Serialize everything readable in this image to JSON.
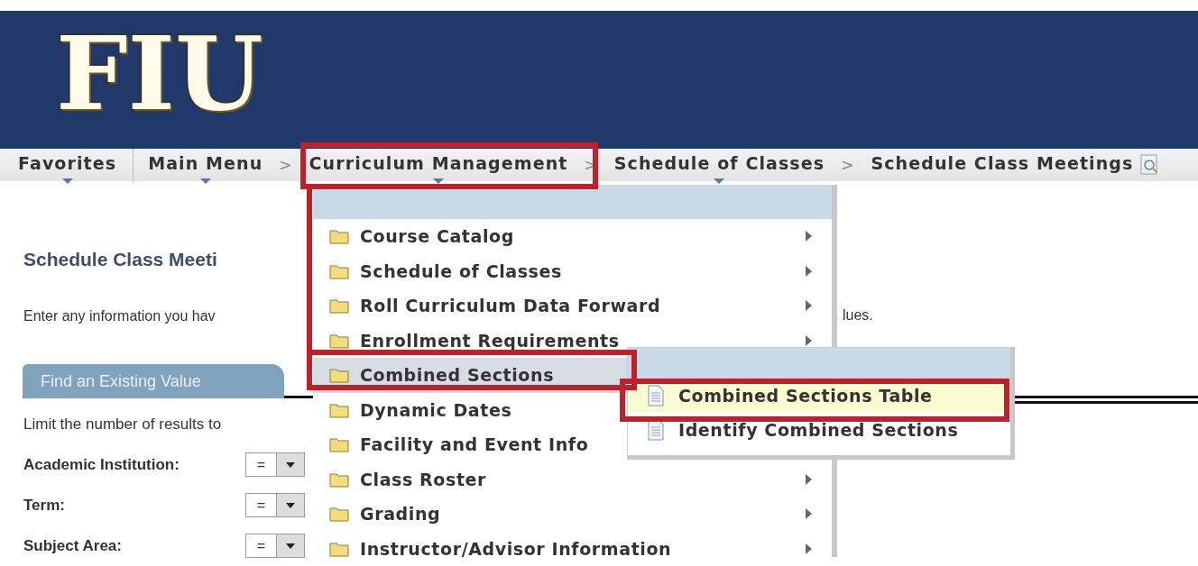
{
  "banner": {
    "logo": "FIU"
  },
  "nav": [
    {
      "label": "Favorites",
      "dropdown": true
    },
    {
      "label": "Main Menu",
      "dropdown": true,
      "divider_before": true
    },
    {
      "label": "Curriculum Management",
      "dropdown": true,
      "separator": ">"
    },
    {
      "label": "Schedule of Classes",
      "dropdown": true,
      "separator": ">"
    },
    {
      "label": "Schedule Class Meetings",
      "dropdown": false,
      "separator": ">"
    }
  ],
  "page": {
    "title": "Schedule Class Meeti",
    "instructions": "Enter any information you hav",
    "instructions_tail": "lues.",
    "tab": "Find an Existing Value",
    "limit_text": "Limit the number of results to",
    "fields": [
      {
        "label": "Academic Institution:",
        "operator": "="
      },
      {
        "label": "Term:",
        "operator": "="
      },
      {
        "label": "Subject Area:",
        "operator": "="
      }
    ]
  },
  "menu": {
    "items": [
      {
        "label": "Course Catalog",
        "arrow": true,
        "selected": false
      },
      {
        "label": "Schedule of Classes",
        "arrow": true,
        "selected": false
      },
      {
        "label": "Roll Curriculum Data Forward",
        "arrow": true,
        "selected": false
      },
      {
        "label": "Enrollment Requirements",
        "arrow": true,
        "selected": false
      },
      {
        "label": "Combined Sections",
        "arrow": false,
        "selected": true
      },
      {
        "label": "Dynamic Dates",
        "arrow": false,
        "selected": false
      },
      {
        "label": "Facility and Event Info",
        "arrow": false,
        "selected": false
      },
      {
        "label": "Class Roster",
        "arrow": true,
        "selected": false
      },
      {
        "label": "Grading",
        "arrow": true,
        "selected": false
      },
      {
        "label": "Instructor/Advisor Information",
        "arrow": true,
        "selected": false
      }
    ]
  },
  "submenu": {
    "items": [
      {
        "label": "Combined Sections Table",
        "selected": true
      },
      {
        "label": "Identify Combined Sections",
        "selected": false
      }
    ]
  }
}
